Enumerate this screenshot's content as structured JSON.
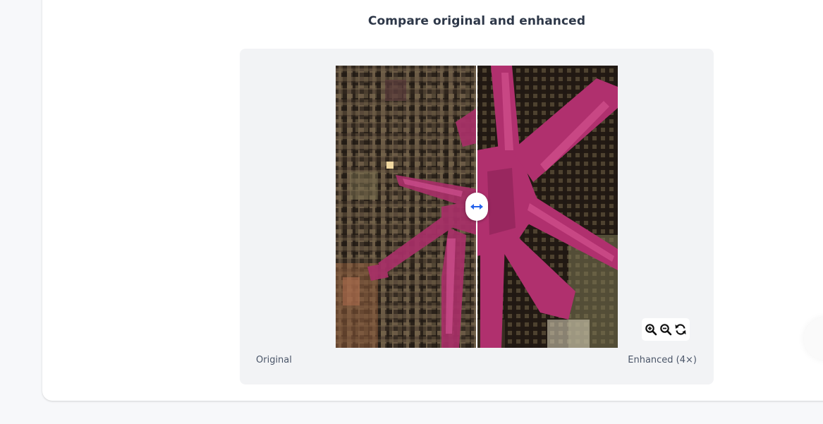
{
  "compare": {
    "title": "Compare original and enhanced",
    "label_original": "Original",
    "label_enhanced": "Enhanced (4×)",
    "slider_position": 0.5
  },
  "zoom_controls": {
    "zoom_in_icon": "zoom-in-icon",
    "zoom_out_icon": "zoom-out-icon",
    "reset_icon": "refresh-icon"
  },
  "colors": {
    "accent": "#2563eb",
    "divider": "#ffffff",
    "starfish": "#b0306e",
    "panel_bg": "#f2f3f5"
  }
}
